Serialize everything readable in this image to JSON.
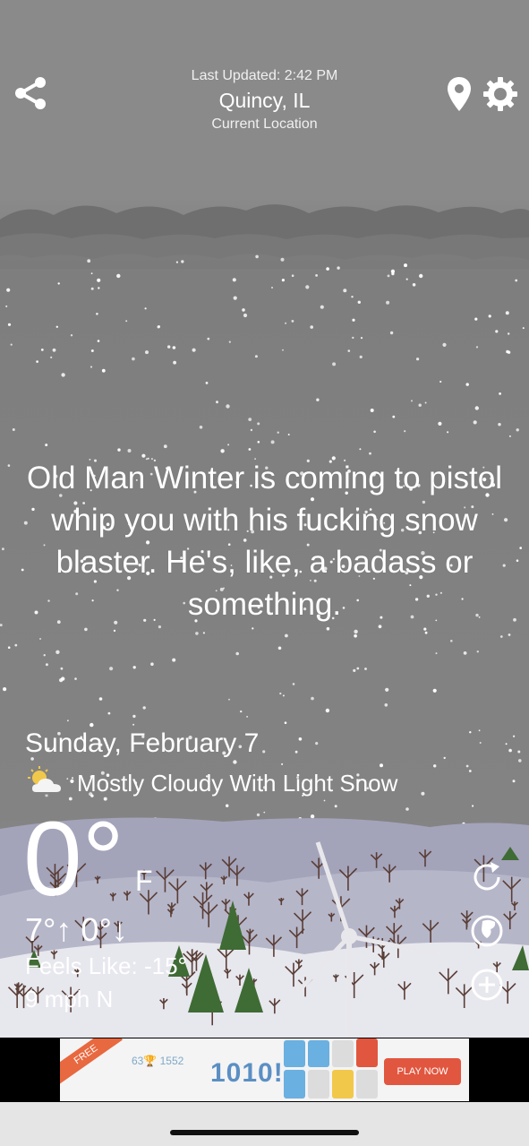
{
  "header": {
    "last_updated": "Last Updated: 2:42 PM",
    "city": "Quincy, IL",
    "location_label": "Current Location"
  },
  "quote": "Old Man Winter is coming to pistol whip you with his fucking snow blaster. He's, like, a badass or something.",
  "forecast": {
    "date": "Sunday, February 7",
    "condition": "Mostly Cloudy With Light Snow",
    "condition_icon": "cloud-sun-snow-icon",
    "temperature": "0°",
    "unit": "F",
    "high_low": "7°↑ 0°↓",
    "feels_like": "Feels Like: -15°",
    "wind": "9 mph N"
  },
  "icons": {
    "share": "share-icon",
    "location": "location-pin-icon",
    "settings": "gear-icon",
    "refresh": "refresh-icon",
    "locations": "locations-icon",
    "add": "add-icon"
  },
  "ad": {
    "ribbon": "FREE",
    "score": "63🏆 1552",
    "logo": "1010!",
    "cta": "PLAY NOW"
  },
  "colors": {
    "sky": "#8a8a8a",
    "cloud_band": "#6e6e6e",
    "snow_ground": "#e9e9ef",
    "hills": "#9d9db4",
    "tree_green": "#3f6b34",
    "ad_accent": "#e1563f"
  }
}
